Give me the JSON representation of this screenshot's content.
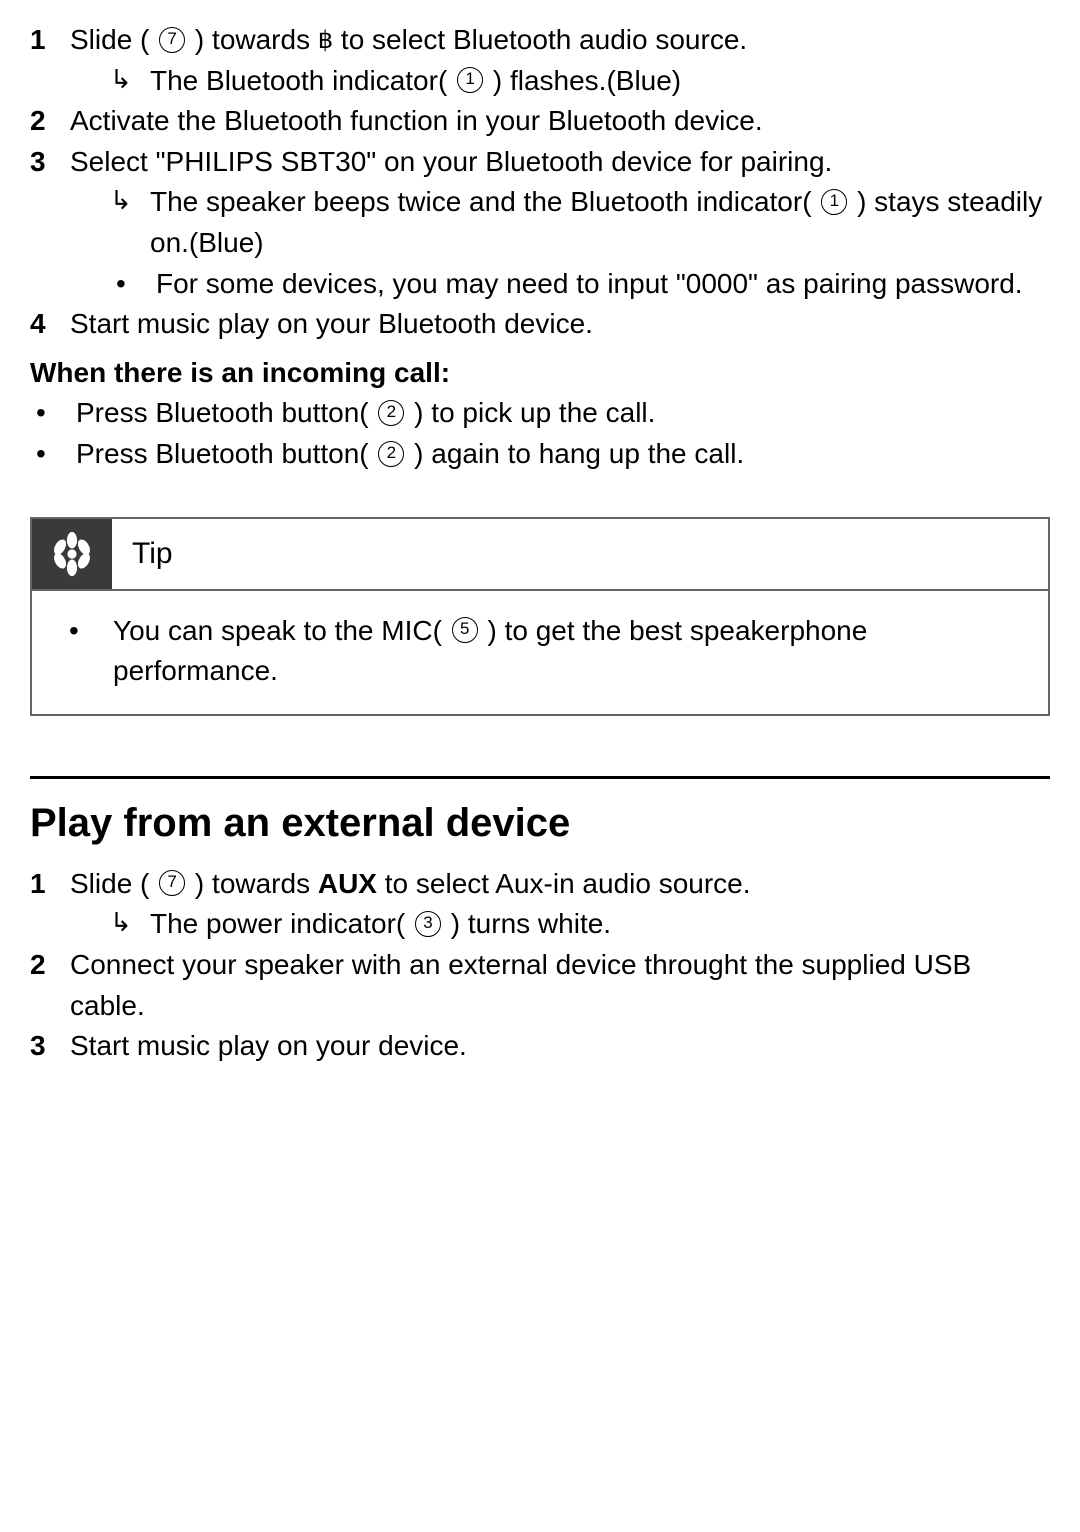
{
  "steps1": {
    "s1_before": "Slide ( ",
    "s1_icon": "⑦",
    "s1_mid": " ) towards ",
    "s1_after": " to select Bluetooth audio source.",
    "s1_sub_before": "The Bluetooth indicator( ",
    "s1_sub_icon": "①",
    "s1_sub_after": " ) flashes.(Blue)",
    "s2": "Activate the Bluetooth function in your Bluetooth device.",
    "s3": "Select \"PHILIPS SBT30\" on your Bluetooth device for pairing.",
    "s3_sub1_before": "The speaker beeps twice and the Bluetooth indicator( ",
    "s3_sub1_icon": "①",
    "s3_sub1_after": " ) stays steadily on.(Blue)",
    "s3_sub2": "For some devices, you may need to input \"0000\" as pairing password.",
    "s4": "Start music play on your Bluetooth device."
  },
  "incoming": {
    "heading": "When there is an incoming call:",
    "b1_before": "Press Bluetooth button( ",
    "b1_icon": "②",
    "b1_after": " ) to pick up the call.",
    "b2_before": "Press Bluetooth button( ",
    "b2_icon": "②",
    "b2_after": " ) again to hang up the call."
  },
  "tip": {
    "title": "Tip",
    "text_before": "You can speak to the MIC( ",
    "text_icon": "⑤",
    "text_after": " ) to get the best speakerphone performance."
  },
  "section2": {
    "heading": "Play from an external device",
    "s1_a": "Slide ( ",
    "s1_icon": "⑦",
    "s1_b": " ) towards ",
    "s1_c": "AUX",
    "s1_d": " to select Aux-in audio source.",
    "s1_sub_a": "The power indicator( ",
    "s1_sub_icon": "③",
    "s1_sub_b": " ) turns white.",
    "s2": "Connect your speaker with an external device throught the supplied USB cable.",
    "s3": "Start music play on your device."
  },
  "nums": {
    "n1": "1",
    "n2": "2",
    "n3": "3",
    "n4": "4"
  },
  "circ": {
    "c1": "1",
    "c2": "2",
    "c3": "3",
    "c5": "5",
    "c7": "7"
  }
}
